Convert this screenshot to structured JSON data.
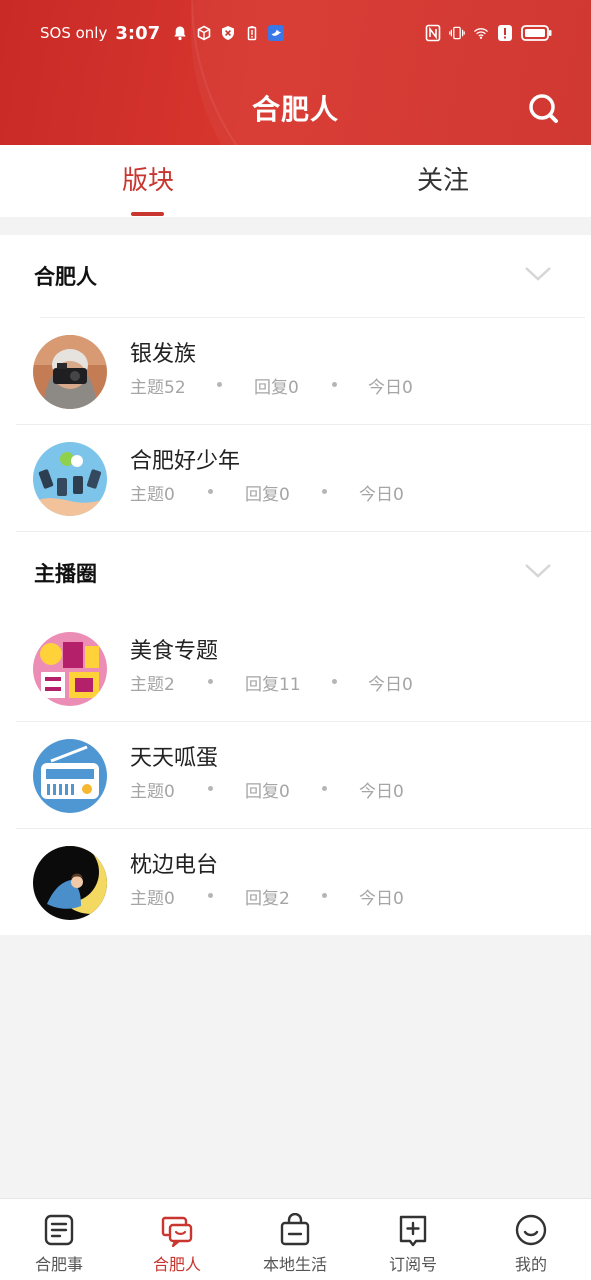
{
  "status_bar": {
    "carrier": "SOS only",
    "time": "3:07"
  },
  "header": {
    "title": "合肥人"
  },
  "tabs": [
    {
      "label": "版块",
      "active": true
    },
    {
      "label": "关注",
      "active": false
    }
  ],
  "groups": [
    {
      "title": "合肥人",
      "forums": [
        {
          "name": "银发族",
          "topics": "主题52",
          "replies": "回复0",
          "today": "今日0",
          "avatar": "camera-photo"
        },
        {
          "name": "合肥好少年",
          "topics": "主题0",
          "replies": "回复0",
          "today": "今日0",
          "avatar": "phones-illustration"
        }
      ]
    },
    {
      "title": "主播圈",
      "forums": [
        {
          "name": "美食专题",
          "topics": "主题2",
          "replies": "回复11",
          "today": "今日0",
          "avatar": "food-logo"
        },
        {
          "name": "天天呱蛋",
          "topics": "主题0",
          "replies": "回复0",
          "today": "今日0",
          "avatar": "radio-illustration"
        },
        {
          "name": "枕边电台",
          "topics": "主题0",
          "replies": "回复2",
          "today": "今日0",
          "avatar": "moon-illustration"
        }
      ]
    }
  ],
  "bottom_nav": [
    {
      "label": "合肥事",
      "icon": "news-icon",
      "active": false
    },
    {
      "label": "合肥人",
      "icon": "chat-icon",
      "active": true
    },
    {
      "label": "本地生活",
      "icon": "shopping-bag-icon",
      "active": false
    },
    {
      "label": "订阅号",
      "icon": "subscribe-icon",
      "active": false
    },
    {
      "label": "我的",
      "icon": "smile-icon",
      "active": false
    }
  ],
  "colors": {
    "brand_red": "#c9362f",
    "text_gray": "#a5a5a5"
  }
}
